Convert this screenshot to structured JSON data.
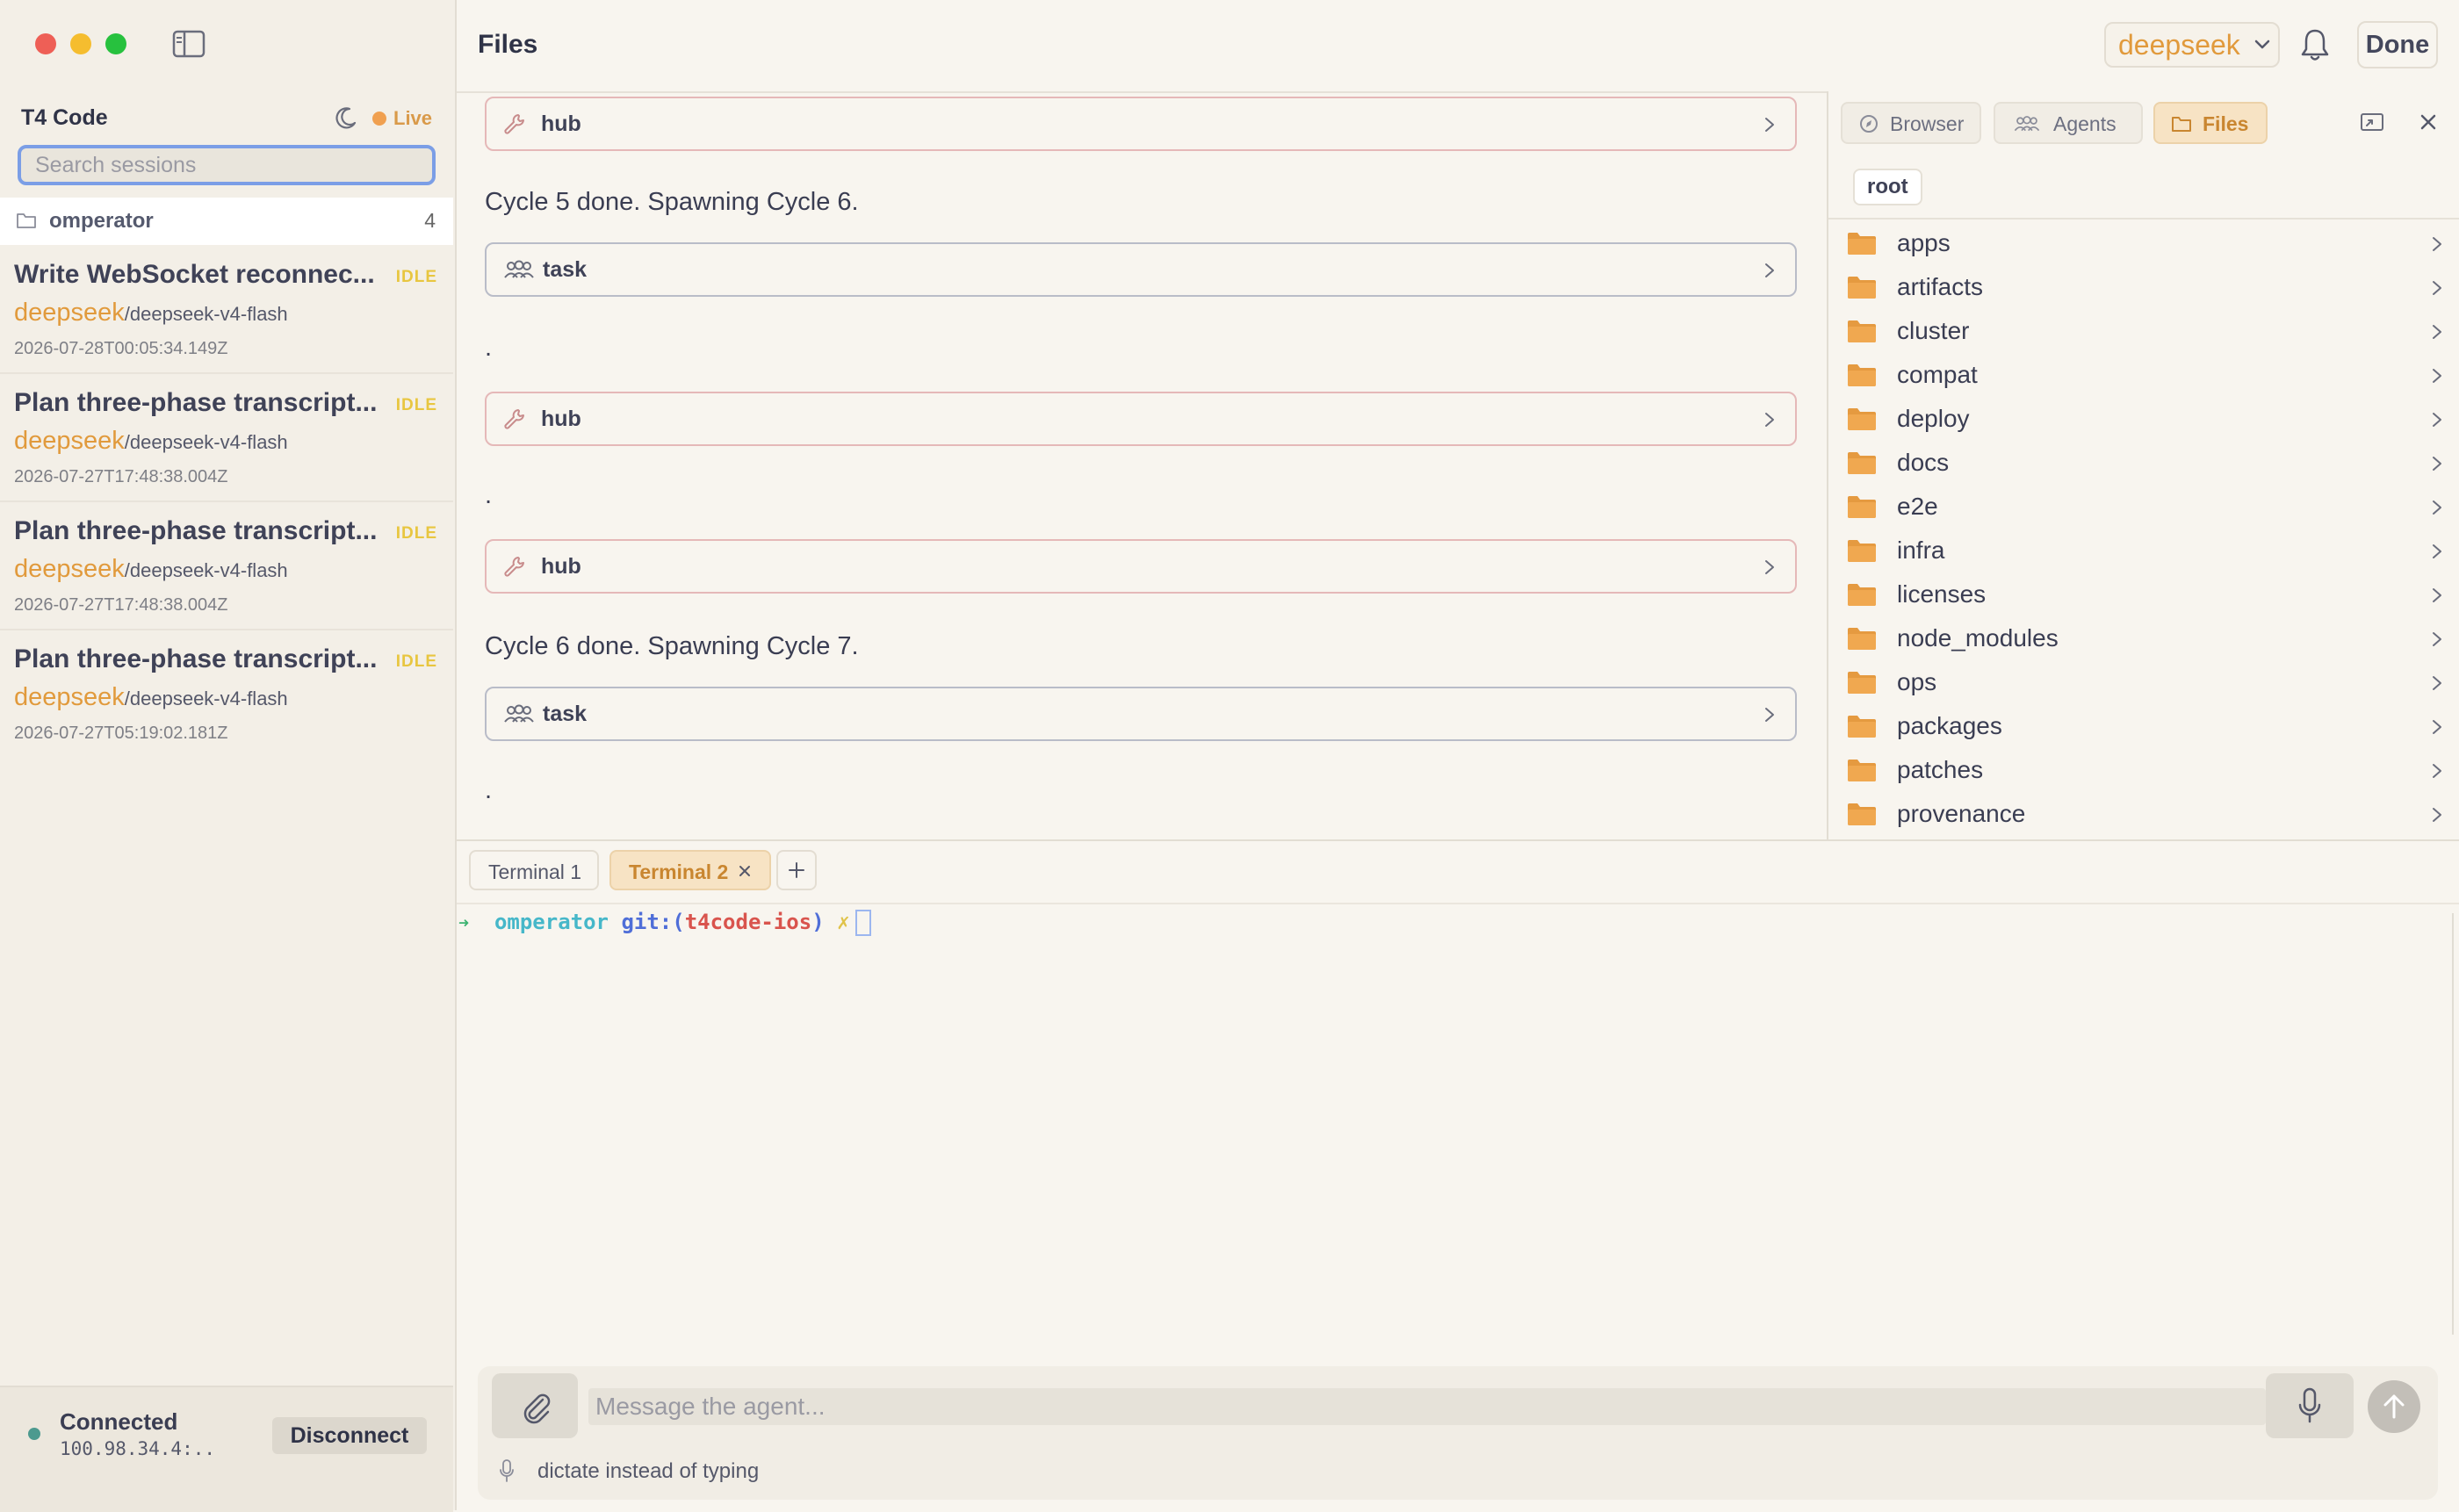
{
  "app": {
    "title": "T4 Code",
    "live_label": "Live"
  },
  "search": {
    "placeholder": "Search sessions"
  },
  "group": {
    "name": "omperator",
    "count": "4"
  },
  "sessions": [
    {
      "title": "Write WebSocket reconnec...",
      "status": "IDLE",
      "provider": "deepseek",
      "model": "/deepseek-v4-flash",
      "time": "2026-07-28T00:05:34.149Z"
    },
    {
      "title": "Plan three-phase transcript...",
      "status": "IDLE",
      "provider": "deepseek",
      "model": "/deepseek-v4-flash",
      "time": "2026-07-27T17:48:38.004Z"
    },
    {
      "title": "Plan three-phase transcript...",
      "status": "IDLE",
      "provider": "deepseek",
      "model": "/deepseek-v4-flash",
      "time": "2026-07-27T17:48:38.004Z"
    },
    {
      "title": "Plan three-phase transcript...",
      "status": "IDLE",
      "provider": "deepseek",
      "model": "/deepseek-v4-flash",
      "time": "2026-07-27T05:19:02.181Z"
    }
  ],
  "connection": {
    "status": "Connected",
    "address": "100.98.34.4:..",
    "disconnect_label": "Disconnect"
  },
  "header": {
    "title": "Files",
    "model": "deepseek",
    "done_label": "Done"
  },
  "chat": {
    "items": [
      {
        "kind": "tool",
        "icon": "wrench-icon",
        "label": "hub"
      },
      {
        "kind": "text",
        "text": "Cycle 5 done. Spawning Cycle 6."
      },
      {
        "kind": "tool",
        "icon": "people-icon",
        "label": "task"
      },
      {
        "kind": "text",
        "text": "."
      },
      {
        "kind": "tool",
        "icon": "wrench-icon",
        "label": "hub"
      },
      {
        "kind": "text",
        "text": "."
      },
      {
        "kind": "tool",
        "icon": "wrench-icon",
        "label": "hub"
      },
      {
        "kind": "text",
        "text": "Cycle 6 done. Spawning Cycle 7."
      },
      {
        "kind": "tool",
        "icon": "people-icon",
        "label": "task"
      },
      {
        "kind": "text",
        "text": "."
      }
    ]
  },
  "panel": {
    "tabs": [
      {
        "label": "Browser",
        "icon": "compass-icon",
        "active": false
      },
      {
        "label": "Agents",
        "icon": "people-icon",
        "active": false
      },
      {
        "label": "Files",
        "icon": "folder-icon",
        "active": true
      }
    ],
    "path": "root",
    "files": [
      "apps",
      "artifacts",
      "cluster",
      "compat",
      "deploy",
      "docs",
      "e2e",
      "infra",
      "licenses",
      "node_modules",
      "ops",
      "packages",
      "patches",
      "provenance"
    ]
  },
  "terminal": {
    "tabs": [
      {
        "label": "Terminal 1",
        "active": false
      },
      {
        "label": "Terminal 2",
        "active": true
      }
    ],
    "prompt": {
      "arrow": "➜",
      "dir": "omperator",
      "git": "git:(",
      "branch": "t4code-ios",
      "close_paren": ")",
      "x": "✗"
    }
  },
  "composer": {
    "placeholder": "Message the agent...",
    "dictate_hint": "dictate instead of typing"
  },
  "colors": {
    "accent": "#e19a3c",
    "idle": "#e8c640",
    "connected": "#4d9a8f",
    "focus": "#7b9ee6"
  }
}
